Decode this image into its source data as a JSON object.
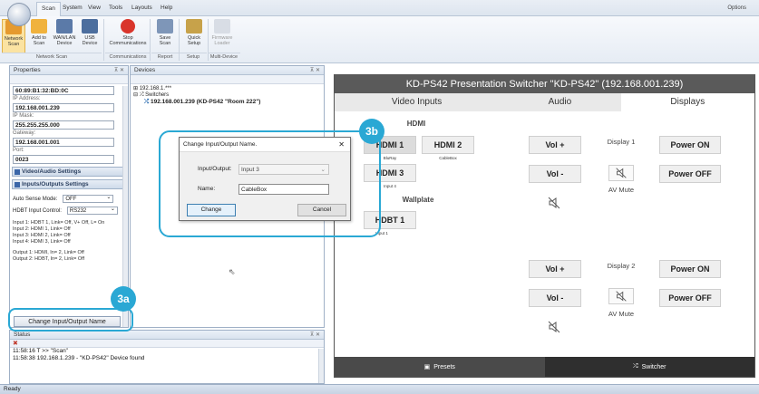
{
  "ribbon": {
    "tabs": [
      "Scan",
      "System",
      "View",
      "Tools",
      "Layouts",
      "Help"
    ],
    "options_label": "Options",
    "buttons": [
      {
        "label": "Network Scan"
      },
      {
        "label": "Add to Scan"
      },
      {
        "label": "WAN/LAN Device"
      },
      {
        "label": "USB Device"
      },
      {
        "label": "Stop Communications"
      },
      {
        "label": "Save Scan"
      },
      {
        "label": "Quick Setup"
      },
      {
        "label": "Firmware Loader"
      }
    ],
    "groups": [
      "Network Scan",
      "Communications",
      "Report",
      "Setup",
      "Multi-Device"
    ]
  },
  "properties": {
    "title": "Properties",
    "fields": [
      {
        "label": "",
        "value": "60:89:B1:32:BD:0C"
      },
      {
        "label": "IP Address:",
        "value": "192.168.001.239"
      },
      {
        "label": "IP Mask:",
        "value": "255.255.255.000"
      },
      {
        "label": "Gateway:",
        "value": "192.168.001.001"
      },
      {
        "label": "Port:",
        "value": "0023"
      }
    ],
    "section_video_audio": "Video/Audio Settings",
    "section_io": "Inputs/Outputs Settings",
    "auto_sense_label": "Auto Sense Mode:",
    "auto_sense_value": "OFF",
    "hdbt_label": "HDBT Input Control:",
    "hdbt_value": "RS232",
    "input_lines": [
      "Input 1:   HDBT 1, Link= Off, V+ Off, L= On",
      "Input 2:   HDMI 1, Link= Off",
      "Input 3:   HDMI 2, Link= Off",
      "Input 4:   HDMI 3, Link= Off"
    ],
    "output_lines": [
      "Output 1:  HDMI, In= 2, Link= Off",
      "Output 2:  HDBT, In= 2, Link= Off"
    ],
    "change_io_button": "Change Input/Output Name"
  },
  "devices": {
    "title": "Devices",
    "tree": [
      "192.168.1.***",
      "Switchers",
      "192.168.001.239 (KD-PS42 \"Room 222\")"
    ]
  },
  "status": {
    "title": "Status",
    "lines": [
      "11:58:16  T >> \"Scan\"",
      "11:58:38  192.168.1.239 - \"KD-PS42\" Device found"
    ]
  },
  "statusbar": {
    "text": "Ready"
  },
  "remote": {
    "title": "KD-PS42 Presentation Switcher \"KD-PS42\" (192.168.001.239)",
    "tabs": [
      "Video Inputs",
      "Audio",
      "Displays"
    ],
    "hdmi_label": "HDMI",
    "hdmi_buttons": [
      {
        "label": "HDMI 1",
        "sub": "BluRay"
      },
      {
        "label": "HDMI 2",
        "sub": "CableBox"
      },
      {
        "label": "HDMI 3",
        "sub": "Input 4"
      }
    ],
    "wallplate_label": "Wallplate",
    "hdbt_button": {
      "label": "HDBT 1",
      "sub": "Input 1"
    },
    "vol_plus": "Vol +",
    "vol_minus": "Vol -",
    "display1_label": "Display 1",
    "display2_label": "Display 2",
    "av_mute": "AV Mute",
    "power_on": "Power ON",
    "power_off": "Power OFF",
    "footer_presets": "Presets",
    "footer_switcher": "Switcher"
  },
  "dialog": {
    "title": "Change Input/Output Name.",
    "io_label": "Input/Output:",
    "io_value": "Input 3",
    "name_label": "Name:",
    "name_value": "CableBox",
    "change_button": "Change",
    "cancel_button": "Cancel"
  },
  "callouts": {
    "a": "3a",
    "b": "3b"
  }
}
